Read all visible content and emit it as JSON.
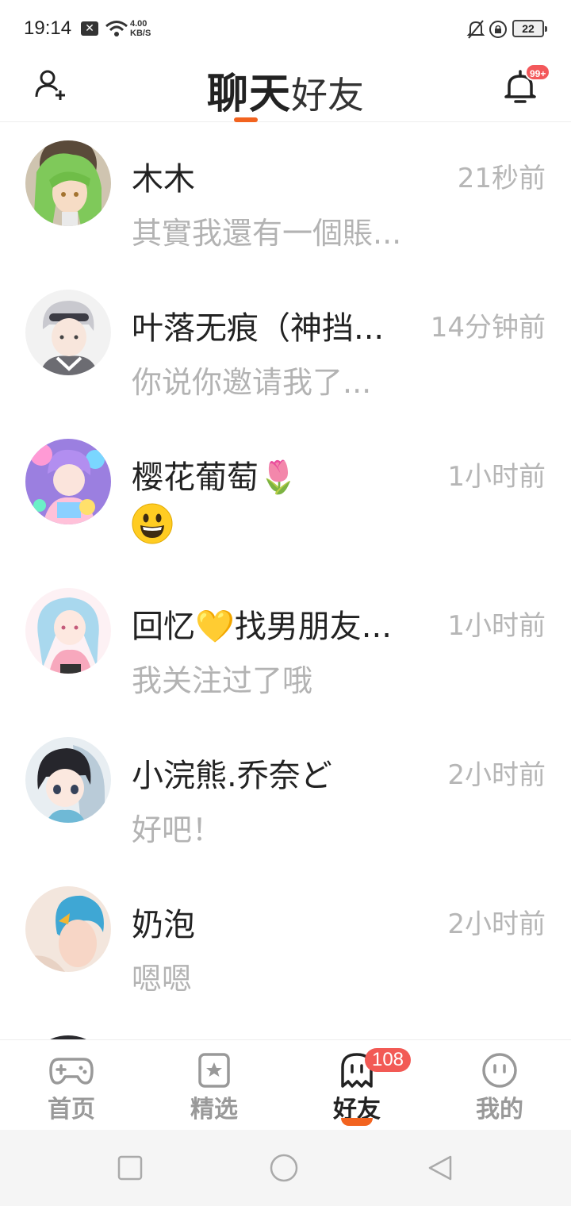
{
  "status_bar": {
    "time": "19:14",
    "net_speed_value": "4.00",
    "net_speed_unit": "KB/S",
    "battery": "22"
  },
  "header": {
    "tab_chat": "聊天",
    "tab_friends": "好友",
    "bell_badge": "99+",
    "accent_color": "#f2631f"
  },
  "chats": [
    {
      "name": "木木",
      "time": "21秒前",
      "message": "其實我還有一個賬..."
    },
    {
      "name": "叶落无痕（神挡...",
      "time": "14分钟前",
      "message": "你说你邀请我了..."
    },
    {
      "name": "樱花葡萄🌷",
      "time": "1小时前",
      "message": "",
      "message_icon": "grinning-face-emoji"
    },
    {
      "name": "回忆💛找男朋友...",
      "time": "1小时前",
      "message": "我关注过了哦"
    },
    {
      "name": "小浣熊.乔奈ど",
      "time": "2小时前",
      "message": "好吧！"
    },
    {
      "name": "奶泡",
      "time": "2小时前",
      "message": "嗯嗯"
    }
  ],
  "bottom_nav": {
    "items": [
      {
        "label": "首页",
        "icon": "gamepad-icon"
      },
      {
        "label": "精选",
        "icon": "star-square-icon"
      },
      {
        "label": "好友",
        "icon": "ghost-icon",
        "badge": "108",
        "active": true
      },
      {
        "label": "我的",
        "icon": "smiley-face-icon"
      }
    ]
  },
  "system_nav": {
    "buttons": [
      "recents-square-icon",
      "home-circle-icon",
      "back-triangle-icon"
    ]
  }
}
